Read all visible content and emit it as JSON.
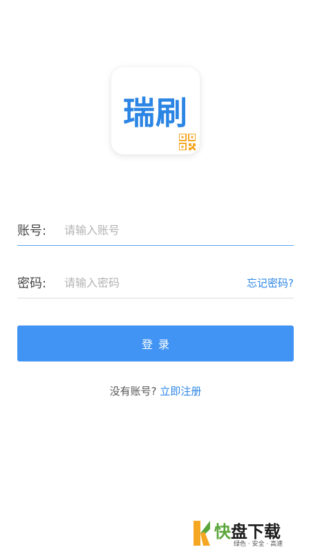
{
  "app": {
    "logo_text": "瑞刷",
    "brand_color": "#2b85e4",
    "qr_color": "#f5a623"
  },
  "form": {
    "account": {
      "label": "账号:",
      "placeholder": "请输入账号",
      "value": ""
    },
    "password": {
      "label": "密码:",
      "placeholder": "请输入密码",
      "value": "",
      "forgot_label": "忘记密码?"
    },
    "login_label": "登录"
  },
  "register": {
    "prompt": "没有账号? ",
    "link_label": "立即注册"
  },
  "watermark": {
    "brand_first": "快",
    "brand_rest": "盘下载",
    "tagline": "绿色 · 安全 · 高速"
  },
  "colors": {
    "primary_button": "#4294f4",
    "link": "#2b85e4",
    "active_underline": "#5aa2ee"
  }
}
